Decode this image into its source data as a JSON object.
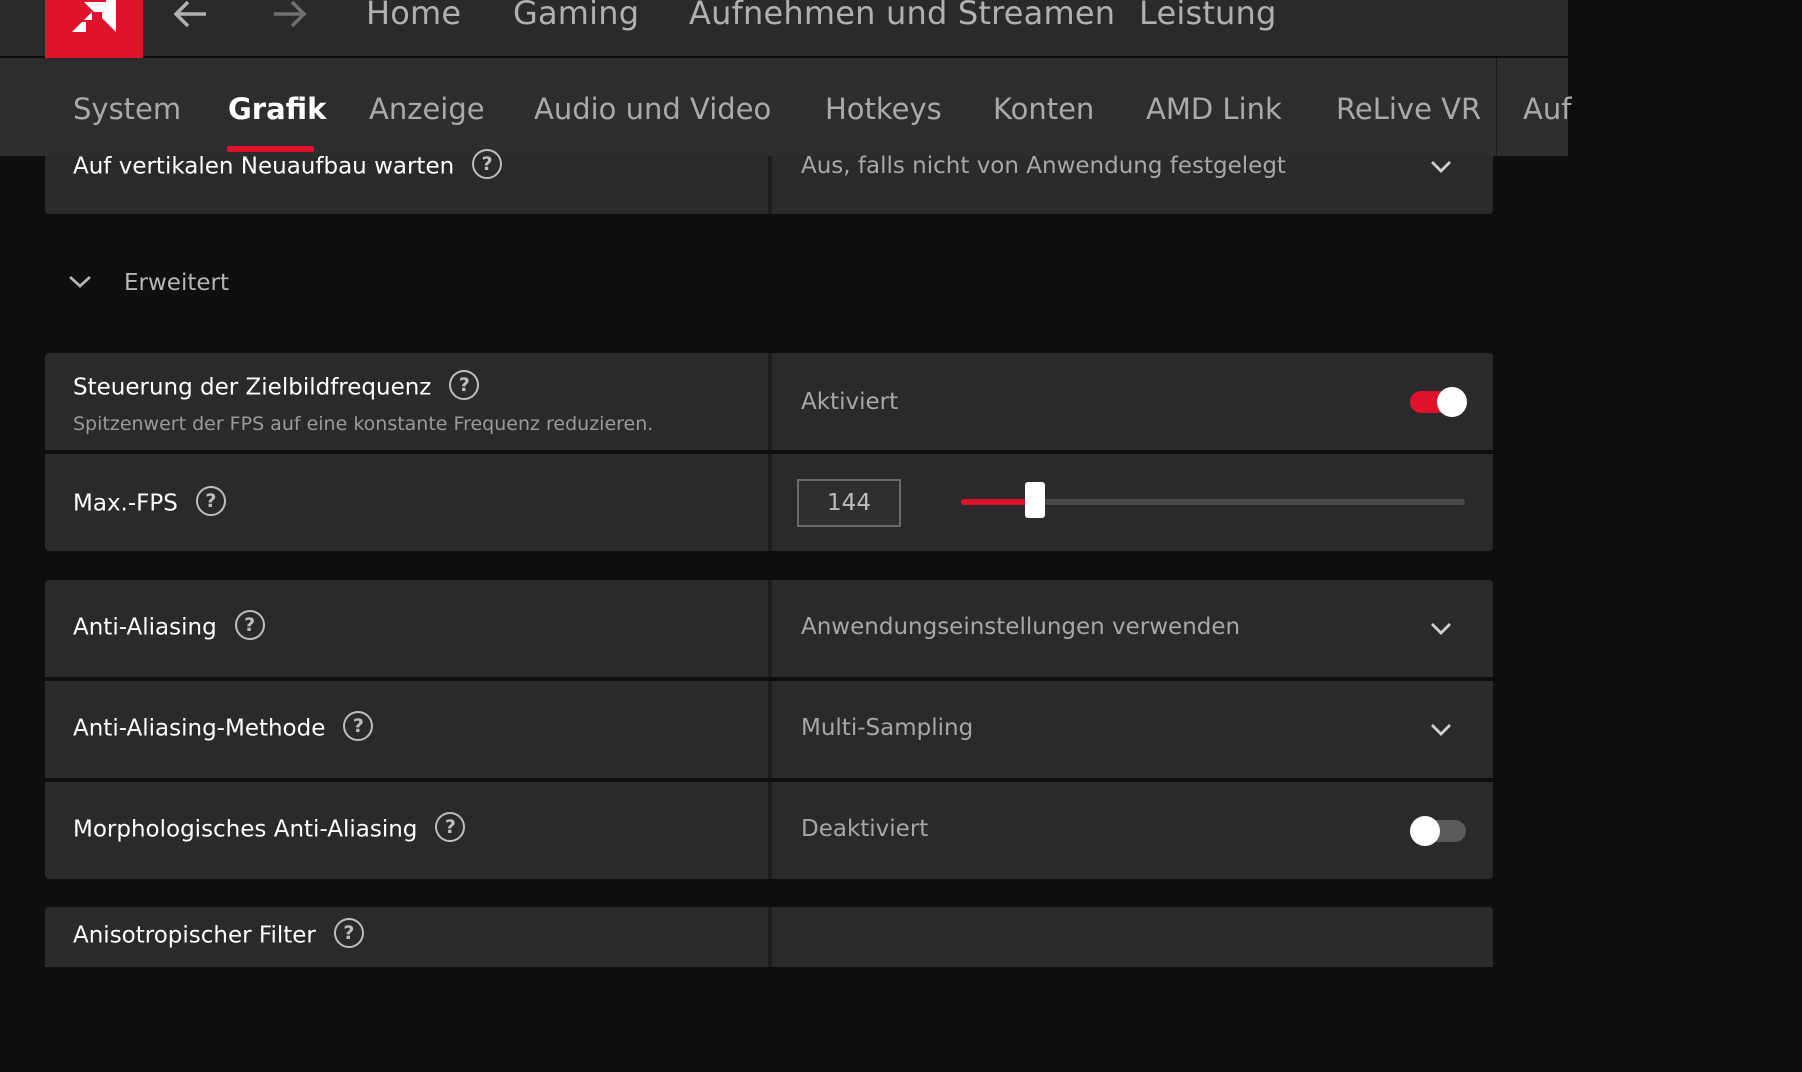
{
  "topnav": {
    "logo": "amd-logo",
    "back_icon": "arrow-left-icon",
    "forward_icon": "arrow-right-icon",
    "links": [
      "Home",
      "Gaming",
      "Aufnehmen und Streamen",
      "Leistung"
    ]
  },
  "tabs": {
    "items": [
      "System",
      "Grafik",
      "Anzeige",
      "Audio und Video",
      "Hotkeys",
      "Konten",
      "AMD Link",
      "ReLive VR",
      "Auf"
    ],
    "active": "Grafik"
  },
  "settings": {
    "vsync": {
      "label": "Auf vertikalen Neuaufbau warten",
      "value": "Aus, falls nicht von Anwendung festgelegt"
    },
    "section": "Erweitert",
    "frtc": {
      "label": "Steuerung der Zielbildfrequenz",
      "description": "Spitzenwert der FPS auf eine konstante Frequenz reduzieren.",
      "value": "Aktiviert",
      "enabled": true
    },
    "maxfps": {
      "label": "Max.-FPS",
      "value": "144",
      "slider_fraction": 0.147
    },
    "aa": {
      "label": "Anti-Aliasing",
      "value": "Anwendungseinstellungen verwenden"
    },
    "aa_method": {
      "label": "Anti-Aliasing-Methode",
      "value": "Multi-Sampling"
    },
    "mlaa": {
      "label": "Morphologisches Anti-Aliasing",
      "value": "Deaktiviert",
      "enabled": false
    },
    "next_partial": {
      "label": "Anisotropischer Filter"
    }
  },
  "help_glyph": "?",
  "colors": {
    "accent": "#e0112b",
    "background": "#0e0e10",
    "card": "#2a2a2c",
    "topbar": "#2a2a2c"
  }
}
